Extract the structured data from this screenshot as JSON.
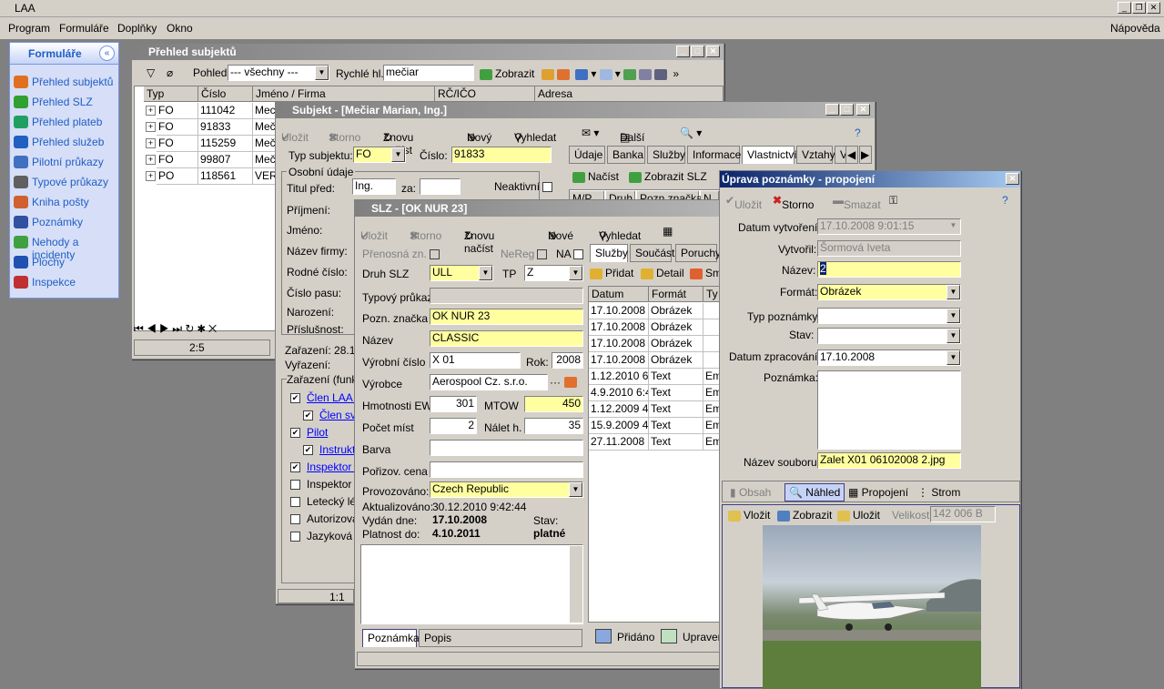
{
  "app": {
    "title": "LAA"
  },
  "menu": [
    "Program",
    "Formuláře",
    "Doplňky",
    "Okno"
  ],
  "help_menu": "Nápověda",
  "sidebar": {
    "title": "Formuláře",
    "items": [
      {
        "label": "Přehled subjektů",
        "color": "#e07020"
      },
      {
        "label": "Přehled SLZ",
        "color": "#30a030"
      },
      {
        "label": "Přehled plateb",
        "color": "#20a060"
      },
      {
        "label": "Přehled služeb",
        "color": "#2060c0"
      },
      {
        "label": "Pilotní průkazy",
        "color": "#4070c0"
      },
      {
        "label": "Typové průkazy",
        "color": "#606060"
      },
      {
        "label": "Kniha pošty",
        "color": "#d06030"
      },
      {
        "label": "Poznámky",
        "color": "#3050a0"
      },
      {
        "label": "Nehody a incidenty",
        "color": "#40a040"
      },
      {
        "label": "Plochy",
        "color": "#2050b0"
      },
      {
        "label": "Inspekce",
        "color": "#c03030"
      }
    ]
  },
  "prehled": {
    "title": "Přehled subjektů",
    "pohled_label": "Pohled",
    "pohled_value": "--- všechny ---",
    "rychle_label": "Rychlé hl.",
    "rychle_value": "mečiar",
    "zobrazit": "Zobrazit",
    "cols": [
      "Typ",
      "Číslo",
      "Jméno / Firma",
      "RČ/IČO",
      "Adresa"
    ],
    "rows": [
      [
        "FO",
        "111042",
        "Mecia"
      ],
      [
        "FO",
        "91833",
        "Mečia"
      ],
      [
        "FO",
        "115259",
        "Mečia"
      ],
      [
        "FO",
        "99807",
        "Mečia"
      ],
      [
        "PO",
        "118561",
        "VERC"
      ]
    ],
    "page": "2:5"
  },
  "subjekt": {
    "title": "Subjekt - [Mečiar Marian, Ing.]",
    "tb": [
      "Uložit",
      "Storno",
      "Znovu načíst",
      "Nový",
      "Vyhledat",
      "Další"
    ],
    "typ_label": "Typ subjektu:",
    "typ_value": "FO",
    "cislo_label": "Číslo:",
    "cislo_value": "91833",
    "tabs": [
      "Údaje",
      "Banka",
      "Služby",
      "Informace",
      "Vlastnictví",
      "Vztahy",
      "V"
    ],
    "osobni": "Osobní údaje",
    "titul_label": "Titul před:",
    "titul_value": "Ing.",
    "za_label": "za:",
    "neaktivni": "Neaktivní",
    "labels": [
      "Příjmení:",
      "Jméno:",
      "Název firmy:",
      "Rodné číslo:",
      "Číslo pasu:",
      "Narození:",
      "Příslušnost:"
    ],
    "zarazeni": "Zařazení: 28.10",
    "vyrazeni": "Vyřazení:",
    "zarazeni_group": "Zařazení (funk",
    "checks": [
      {
        "label": "Člen LAA Č",
        "link": true,
        "checked": true,
        "indent": 0
      },
      {
        "label": "Člen sva",
        "link": true,
        "checked": true,
        "indent": 1
      },
      {
        "label": "Pilot",
        "link": true,
        "checked": true,
        "indent": 0
      },
      {
        "label": "Instrukto",
        "link": true,
        "checked": true,
        "indent": 1
      },
      {
        "label": "Inspektor te",
        "link": true,
        "checked": true,
        "indent": 0
      },
      {
        "label": "Inspektor p",
        "link": false,
        "checked": false,
        "indent": 0
      },
      {
        "label": "Letecký lék",
        "link": false,
        "checked": false,
        "indent": 0
      },
      {
        "label": "Autorizova",
        "link": false,
        "checked": false,
        "indent": 0
      },
      {
        "label": "Jazyková z",
        "link": false,
        "checked": false,
        "indent": 0
      }
    ],
    "vl_tb": [
      "Načíst",
      "Zobrazit SLZ"
    ],
    "vl_cols": [
      "M/P",
      "Druh",
      "Pozn.značka",
      "N"
    ],
    "page": "1:1"
  },
  "slz": {
    "title": "SLZ - [OK NUR 23]",
    "tb": [
      "Uložit",
      "Storno",
      "Znovu načíst",
      "Nové",
      "Vyhledat"
    ],
    "prenosna": "Přenosná zn.",
    "nereg": "NeReg",
    "na": "NA",
    "druh_label": "Druh SLZ",
    "druh_value": "ULL",
    "tp_label": "TP",
    "tp_value": "Z",
    "typovy_label": "Typový průkaz",
    "pozn_label": "Pozn. značka",
    "pozn_value": "OK NUR 23",
    "nazev_label": "Název",
    "nazev_value": "CLASSIC",
    "vyr_label": "Výrobní číslo",
    "vyr_value": "X 01",
    "rok_label": "Rok:",
    "rok_value": "2008",
    "vyrobce_label": "Výrobce",
    "vyrobce_value": "Aerospool Cz. s.r.o.",
    "hmot_label": "Hmotnosti  EW",
    "hmot_value": "301",
    "mtow_label": "MTOW",
    "mtow_value": "450",
    "pocet_label": "Počet míst",
    "pocet_value": "2",
    "nalet_label": "Nálet h.",
    "nalet_value": "35",
    "barva_label": "Barva",
    "poriz_label": "Pořizov. cena",
    "prov_label": "Provozováno:",
    "prov_value": "Czech Republic",
    "akt": "Aktualizováno:",
    "akt_value": "30.12.2010 9:42:44",
    "vydan": "Vydán dne:",
    "vydan_value": "17.10.2008",
    "stav": "Stav:",
    "platnost": "Platnost do:",
    "platnost_value": "4.10.2011",
    "stav_value": "platné",
    "tabs": [
      "Služby",
      "Součásti",
      "Poruchy"
    ],
    "sub_tb": [
      "Přidat",
      "Detail",
      "Sm"
    ],
    "cols": [
      "Datum",
      "Formát",
      "Ty"
    ],
    "rows": [
      [
        "17.10.2008 9",
        "Obrázek",
        ""
      ],
      [
        "17.10.2008 9",
        "Obrázek",
        ""
      ],
      [
        "17.10.2008 9",
        "Obrázek",
        ""
      ],
      [
        "17.10.2008 9",
        "Obrázek",
        ""
      ],
      [
        "1.12.2010 6:",
        "Text",
        "Em"
      ],
      [
        "4.9.2010 6:4",
        "Text",
        "Em"
      ],
      [
        "1.12.2009 4:",
        "Text",
        "Em"
      ],
      [
        "15.9.2009 4:",
        "Text",
        "Em"
      ],
      [
        "27.11.2008 5",
        "Text",
        "Em"
      ]
    ],
    "bottom_tabs": [
      "Poznámka",
      "Popis"
    ],
    "pridano": "Přidáno",
    "upraveno": "Upraver"
  },
  "uprava": {
    "title": "Úprava poznámky - propojení",
    "tb": [
      "Uložit",
      "Storno",
      "Smazat"
    ],
    "dv_label": "Datum vytvoření:",
    "dv_value": "17.10.2008 9:01:15",
    "vytvoril_label": "Vytvořil:",
    "vytvoril_value": "Šormová Iveta",
    "nazev_label": "Název:",
    "nazev_value": "2",
    "format_label": "Formát:",
    "format_value": "Obrázek",
    "typ_label": "Typ poznámky:",
    "stav_label": "Stav:",
    "dz_label": "Datum zpracování:",
    "dz_value": "17.10.2008",
    "poznamka_label": "Poznámka:",
    "soubor_label": "Název souboru:",
    "soubor_value": "Zalet X01 06102008 2.jpg",
    "tabs": [
      "Obsah",
      "Náhled",
      "Propojení",
      "Strom"
    ],
    "img_tb": [
      "Vložit",
      "Zobrazit",
      "Uložit"
    ],
    "velikost_label": "Velikost",
    "velikost_value": "142 006 B"
  }
}
